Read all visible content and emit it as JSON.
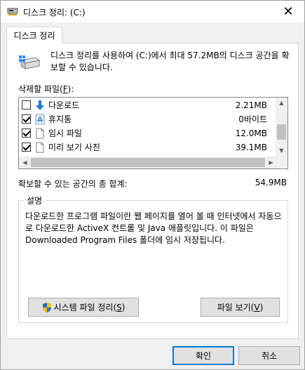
{
  "window": {
    "title": "디스크 정리: (C:)",
    "close_glyph": "✕"
  },
  "tab": {
    "label": "디스크 정리"
  },
  "intro": "디스크 정리를 사용하여 (C:)에서 최대 57.2MB의 디스크 공간을 확보할 수 있습니다.",
  "files_label": {
    "text": "삭제할 파일(",
    "mnemonic": "F",
    "suffix": "):"
  },
  "files": [
    {
      "name": "다운로드",
      "size": "2.21MB",
      "checked": false,
      "icon": "download-icon"
    },
    {
      "name": "휴지통",
      "size": "0바이트",
      "checked": true,
      "icon": "recycle-bin-icon"
    },
    {
      "name": "임시 파일",
      "size": "12.0MB",
      "checked": true,
      "icon": "file-icon"
    },
    {
      "name": "미리 보기 사진",
      "size": "39.1MB",
      "checked": true,
      "icon": "file-icon"
    }
  ],
  "total": {
    "label": "확보할 수 있는 공간의 총 합계:",
    "value": "54.9MB"
  },
  "description": {
    "title": "설명",
    "text": "다운로드한 프로그램 파일이란 웹 페이지를 열어 볼 때 인터넷에서 자동으로 다운로드한 ActiveX 컨트롤 및 Java 애플릿입니다. 이 파일은 Downloaded Program Files 폴더에 임시 저장됩니다."
  },
  "buttons": {
    "cleanup_system": {
      "text": "시스템 파일 정리(",
      "mnemonic": "S",
      "suffix": ")"
    },
    "view_files": {
      "text": "파일 보기(",
      "mnemonic": "V",
      "suffix": ")"
    },
    "ok": "확인",
    "cancel": "취소"
  },
  "colors": {
    "accent": "#0078d7",
    "download_arrow": "#1e7ad6",
    "window_bg": "#f0f0f0"
  }
}
